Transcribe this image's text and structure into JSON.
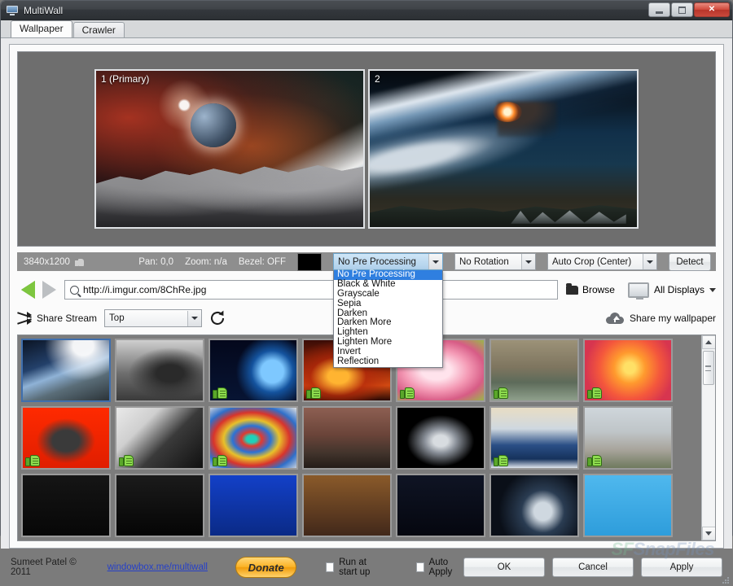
{
  "window": {
    "title": "MultiWall",
    "icon": "monitor-icon",
    "minimize_label": "",
    "maximize_label": "",
    "close_label": "✕"
  },
  "tabs": [
    {
      "label": "Wallpaper",
      "active": true
    },
    {
      "label": "Crawler",
      "active": false
    }
  ],
  "preview": {
    "monitors": [
      {
        "label": "1 (Primary)"
      },
      {
        "label": "2"
      }
    ]
  },
  "status": {
    "resolution": "3840x1200",
    "thumb_icon": "thumbs-up-icon",
    "pan": "Pan: 0,0",
    "zoom": "Zoom: n/a",
    "bezel": "Bezel: OFF",
    "color_swatch": "#000000",
    "preprocessing_value": "No Pre Processing",
    "rotation_value": "No Rotation",
    "crop_value": "Auto Crop (Center)",
    "detect_label": "Detect"
  },
  "dropdown": {
    "open": true,
    "selected": "No Pre Processing",
    "options": [
      "No Pre Processing",
      "Black & White",
      "Grayscale",
      "Sepia",
      "Darken",
      "Darken More",
      "Lighten",
      "Lighten More",
      "Invert",
      "Reflection"
    ]
  },
  "urlbar": {
    "back_icon": "back-arrow-icon",
    "forward_icon": "forward-arrow-icon",
    "search_icon": "search-icon",
    "value": "http://i.imgur.com/8ChRe.jpg",
    "placeholder": "http://",
    "browse_label": "Browse",
    "displays_label": "All Displays"
  },
  "share": {
    "shuffle_icon": "shuffle-icon",
    "stream_label": "Share Stream",
    "stream_value": "Top",
    "refresh_icon": "refresh-icon",
    "share_wallpaper_label": "Share my wallpaper"
  },
  "gallery": {
    "scroll_up": "▲",
    "scroll_down": "▼",
    "thumbnails": [
      {
        "name": "earth-horizon",
        "liked": false,
        "selected": true
      },
      {
        "name": "rorschach-noir",
        "liked": false,
        "selected": false
      },
      {
        "name": "blue-planet",
        "liked": true,
        "selected": false
      },
      {
        "name": "fire-dragon",
        "liked": true,
        "selected": false
      },
      {
        "name": "pink-lily",
        "liked": true,
        "selected": false
      },
      {
        "name": "roman-baths",
        "liked": true,
        "selected": false
      },
      {
        "name": "safari-sunset",
        "liked": true,
        "selected": false
      },
      {
        "name": "red-warrior",
        "liked": true,
        "selected": false
      },
      {
        "name": "typewriter",
        "liked": true,
        "selected": false
      },
      {
        "name": "paint-swirl",
        "liked": true,
        "selected": false
      },
      {
        "name": "rust-ruins",
        "liked": false,
        "selected": false
      },
      {
        "name": "star-destroyer",
        "liked": false,
        "selected": false
      },
      {
        "name": "great-wave",
        "liked": true,
        "selected": false
      },
      {
        "name": "taj-mahal",
        "liked": true,
        "selected": false
      },
      {
        "name": "dark-row-1",
        "liked": false,
        "selected": false
      },
      {
        "name": "dark-row-2",
        "liked": false,
        "selected": false
      },
      {
        "name": "blue-row-3",
        "liked": false,
        "selected": false
      },
      {
        "name": "amber-row-4",
        "liked": false,
        "selected": false
      },
      {
        "name": "night-row-5",
        "liked": false,
        "selected": false
      },
      {
        "name": "globe-row-6",
        "liked": false,
        "selected": false
      },
      {
        "name": "sky-row-7",
        "liked": false,
        "selected": false
      }
    ]
  },
  "watermark": {
    "prefix": "SF",
    "text": "SnapFiles"
  },
  "footer": {
    "copyright": "Sumeet Patel © 2011",
    "link": "windowbox.me/multiwall",
    "donate_label": "Donate",
    "run_at_startup_label": "Run at start up",
    "run_at_startup_checked": false,
    "auto_apply_label": "Auto Apply",
    "auto_apply_checked": false,
    "ok_label": "OK",
    "cancel_label": "Cancel",
    "apply_label": "Apply"
  }
}
